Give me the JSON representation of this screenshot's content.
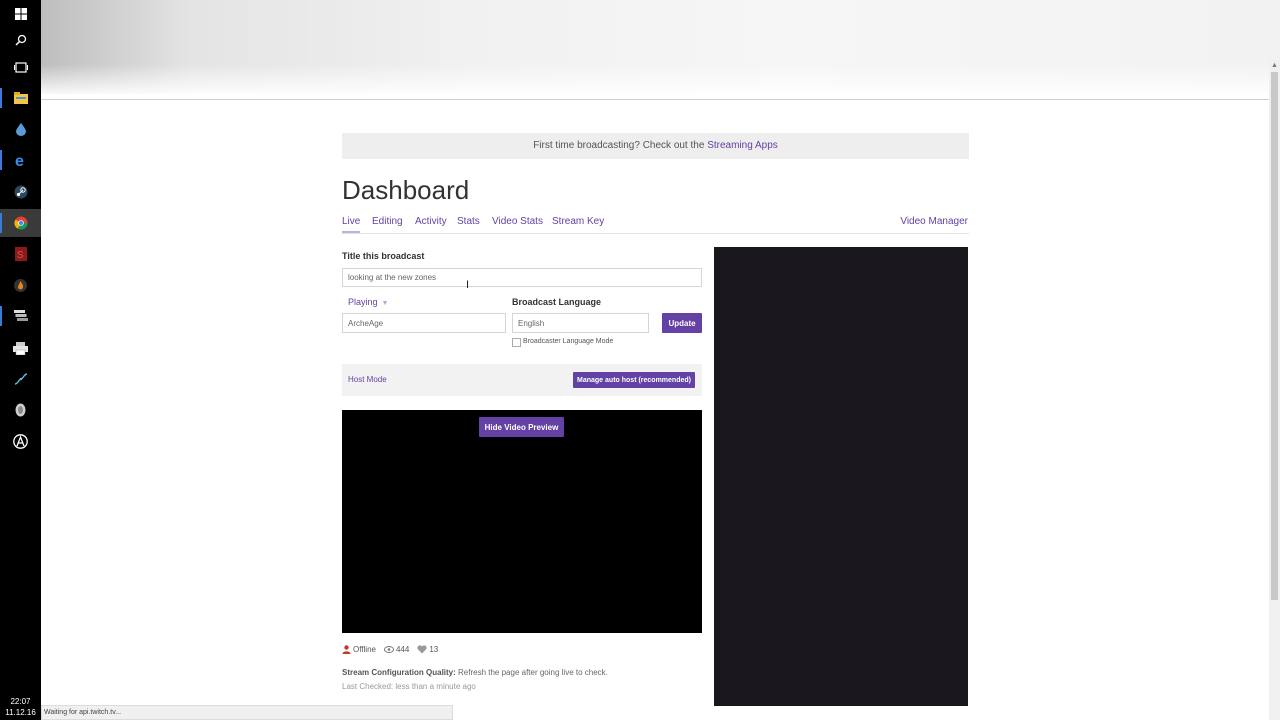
{
  "taskbar": {
    "icons": [
      "windows-start-icon",
      "search-icon",
      "task-view-icon",
      "file-explorer-icon",
      "droplet-app-icon",
      "edge-browser-icon",
      "steam-icon",
      "chrome-icon",
      "red-app-icon",
      "fire-app-icon",
      "stack-app-icon",
      "printer-app-icon",
      "fan-app-icon",
      "shield-app-icon",
      "circle-a-app-icon"
    ],
    "clock_time": "22:07",
    "clock_date": "11.12.16"
  },
  "notice": {
    "text": "First time broadcasting? Check out the ",
    "link": "Streaming Apps"
  },
  "page_title": "Dashboard",
  "tabs": [
    "Live",
    "Editing",
    "Activity",
    "Stats",
    "Video Stats",
    "Stream Key"
  ],
  "video_manager": "Video Manager",
  "broadcast": {
    "title_label": "Title this broadcast",
    "title_value": "looking at the new zones",
    "playing_label": "Playing",
    "game_value": "ArcheAge",
    "language_label": "Broadcast Language",
    "language_value": "English",
    "update_button": "Update",
    "language_mode_label": "Broadcaster Language Mode"
  },
  "host": {
    "label": "Host Mode",
    "button": "Manage auto host (recommended)"
  },
  "video": {
    "hide_button": "Hide Video Preview"
  },
  "stats": {
    "status": "Offline",
    "views": "444",
    "followers": "13"
  },
  "stream_config": {
    "label": "Stream Configuration Quality:",
    "text": " Refresh the page after going live to check.",
    "last_checked": "Last Checked: less than a minute ago"
  },
  "statusbar": "Waiting for api.twitch.tv...",
  "colors": {
    "accent": "#6441a4",
    "chat_bg": "#19171c",
    "offline_icon": "#c0392b"
  }
}
